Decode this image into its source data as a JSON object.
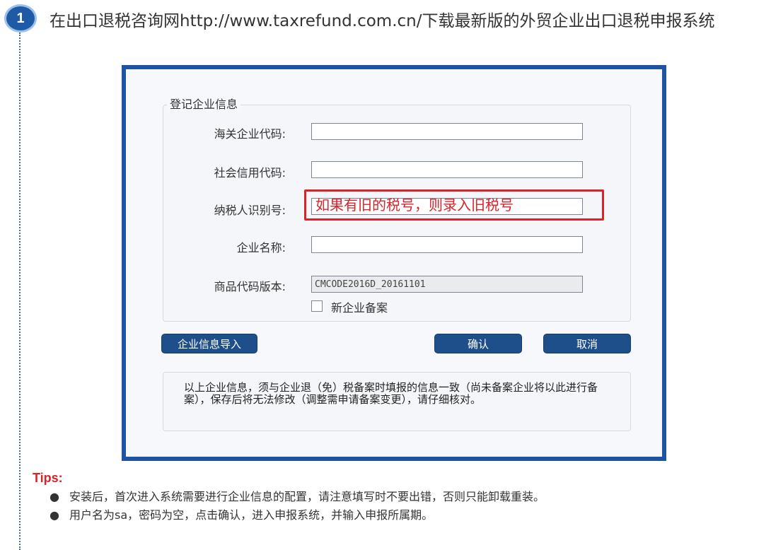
{
  "step": {
    "number": "1"
  },
  "intro": {
    "text": "在出口退税咨询网http://www.taxrefund.com.cn/下载最新版的外贸企业出口退税申报系统"
  },
  "dialog": {
    "group_title": "登记企业信息",
    "fields": {
      "customs_code": {
        "label": "海关企业代码:",
        "value": ""
      },
      "credit_code": {
        "label": "社会信用代码:",
        "value": ""
      },
      "taxpayer_id": {
        "label": "纳税人识别号:",
        "value": ""
      },
      "company_name": {
        "label": "企业名称:",
        "value": ""
      },
      "product_code_version": {
        "label": "商品代码版本:",
        "value": "CMCODE2016D_20161101"
      }
    },
    "checkbox": {
      "label": "新企业备案",
      "checked": false
    },
    "buttons": {
      "import": "企业信息导入",
      "confirm": "确认",
      "cancel": "取消"
    },
    "note": "以上企业信息，须与企业退（免）税备案时填报的信息一致（尚未备案企业将以此进行备案），保存后将无法修改（调整需申请备案变更），请仔细核对。",
    "callout": "如果有旧的税号，则录入旧税号"
  },
  "tips": {
    "title": "Tips:",
    "bullet": "●",
    "items": [
      "安装后，首次进入系统需要进行企业信息的配置，请注意填写时不要出错，否则只能卸载重装。",
      "用户名为sa，密码为空，点击确认，进入申报系统，并输入申报所属期。"
    ]
  },
  "colors": {
    "frame": "#1e54a3",
    "button": "#1f4f8a",
    "callout": "#d9232a",
    "tips_title": "#d9232a"
  }
}
